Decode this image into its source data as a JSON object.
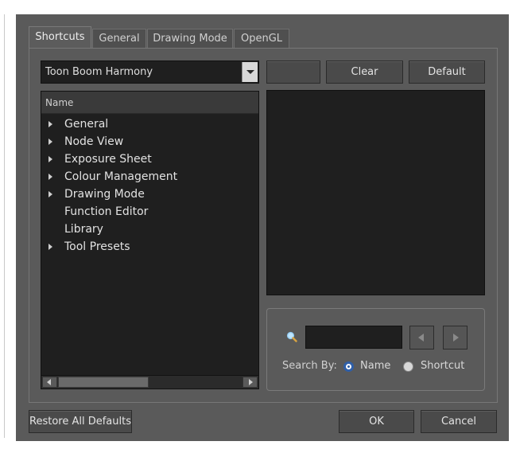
{
  "tabs": [
    {
      "label": "Shortcuts",
      "active": true
    },
    {
      "label": "General",
      "active": false
    },
    {
      "label": "Drawing Mode",
      "active": false
    },
    {
      "label": "OpenGL",
      "active": false
    }
  ],
  "shortcut_set": {
    "selected": "Toon Boom Harmony"
  },
  "buttons": {
    "blank": "",
    "clear": "Clear",
    "default": "Default",
    "restore_all": "Restore All Defaults",
    "ok": "OK",
    "cancel": "Cancel"
  },
  "tree": {
    "header": "Name",
    "items": [
      {
        "label": "General",
        "expandable": true
      },
      {
        "label": "Node View",
        "expandable": true
      },
      {
        "label": "Exposure Sheet",
        "expandable": true
      },
      {
        "label": "Colour Management",
        "expandable": true
      },
      {
        "label": "Drawing Mode",
        "expandable": true
      },
      {
        "label": "Function Editor",
        "expandable": false
      },
      {
        "label": "Library",
        "expandable": false
      },
      {
        "label": "Tool Presets",
        "expandable": true
      }
    ]
  },
  "search": {
    "value": "",
    "search_by_label": "Search By:",
    "options": [
      {
        "label": "Name",
        "checked": true
      },
      {
        "label": "Shortcut",
        "checked": false
      }
    ]
  },
  "icons": {
    "search": "search-icon",
    "prev": "arrow-left-icon",
    "next": "arrow-right-icon",
    "dropdown": "chevron-down-icon",
    "expand": "triangle-right-icon"
  },
  "colors": {
    "dialog_bg": "#5a5a5a",
    "panel_bg": "#1f1f1f",
    "radio_accent": "#2f5fa8"
  }
}
